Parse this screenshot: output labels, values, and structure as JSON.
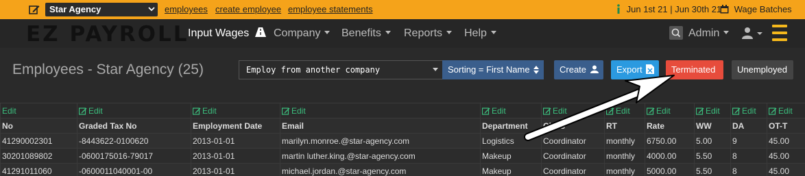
{
  "topbar": {
    "agency": "Star Agency",
    "links": [
      "employees",
      "create employee",
      "employee statements"
    ],
    "date_range": "Jun 1st 21 | Jun 30th 21",
    "wage_batches": "Wage Batches"
  },
  "navbar": {
    "brand": "EZ PAYROLL",
    "items": [
      {
        "label": "Input Wages"
      },
      {
        "label": "Company"
      },
      {
        "label": "Benefits"
      },
      {
        "label": "Reports"
      },
      {
        "label": "Help"
      }
    ],
    "admin": "Admin"
  },
  "header": {
    "title": "Employees - Star Agency (25)",
    "employ_select": "Employ from another company",
    "sorting": "Sorting = First Name",
    "buttons": {
      "create": "Create",
      "export": "Export",
      "terminated": "Terminated",
      "unemployed": "Unemployed"
    }
  },
  "table": {
    "edit_label": "Edit",
    "columns": [
      "No",
      "Graded Tax No",
      "Employment Date",
      "Email",
      "Department",
      "Class",
      "RT",
      "Rate",
      "WW",
      "DA",
      "OT-T"
    ],
    "rows": [
      [
        "41290002301",
        "-8443622-0100620",
        "2013-01-01",
        "marilyn.monroe.@star-agency.com",
        "Logistics",
        "Coordinator",
        "monthly",
        "6750.00",
        "5.00",
        "9",
        "45.00"
      ],
      [
        "30201089802",
        "-0600175016-79017",
        "2013-01-01",
        "martin luther.king.@star-agency.com",
        "Makeup",
        "Coordinator",
        "monthly",
        "4000.00",
        "5.50",
        "8",
        "45.00"
      ],
      [
        "41291011060",
        "-0600011040001-00",
        "2013-01-01",
        "michael.jordan.@star-agency.com",
        "Makeup",
        "Coordinator",
        "monthly",
        "5000.00",
        "5.50",
        "8",
        "45.00"
      ]
    ]
  },
  "colors": {
    "topbar": "#f5a31a",
    "navbar": "#262626",
    "accent_green": "#3cbf7e",
    "terminated": "#e74c3c",
    "export": "#2b9ae0",
    "create": "#3a5e8c"
  }
}
